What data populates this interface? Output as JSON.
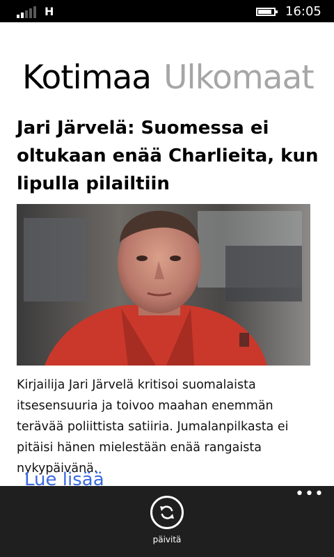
{
  "status_bar": {
    "network_type": "H",
    "time": "16:05",
    "signal_bars": 2,
    "battery_level": 0.85,
    "signal_icon": "signal-strength-icon",
    "battery_icon": "battery-icon"
  },
  "pivot": {
    "tabs": [
      {
        "label": "Kotimaa",
        "active": true
      },
      {
        "label": "Ulkomaat",
        "active": false
      }
    ]
  },
  "article": {
    "headline": "Jari Järvelä: Suomessa ei oltukaan enää Charlieita, kun lipulla pilailtiin",
    "image_icon": "article-photo",
    "summary": "Kirjailija Jari Järvelä kritisoi suomalaista itsesensuuria ja toivoo maahan enemmän terävää poliittista satiiria. Jumalanpilkasta ei pitäisi hänen mielestään enää rangaista nykypäivänä.",
    "read_more": "Lue lisää"
  },
  "app_bar": {
    "refresh_label": "päivitä",
    "refresh_icon": "refresh-icon",
    "more_icon": "more-dots-icon",
    "more_glyph": "•••"
  },
  "colors": {
    "status_bar_bg": "#000000",
    "app_bar_bg": "#1f1f1f",
    "accent_link": "#3a6ae0",
    "inactive_tab": "#a6a6a6"
  }
}
